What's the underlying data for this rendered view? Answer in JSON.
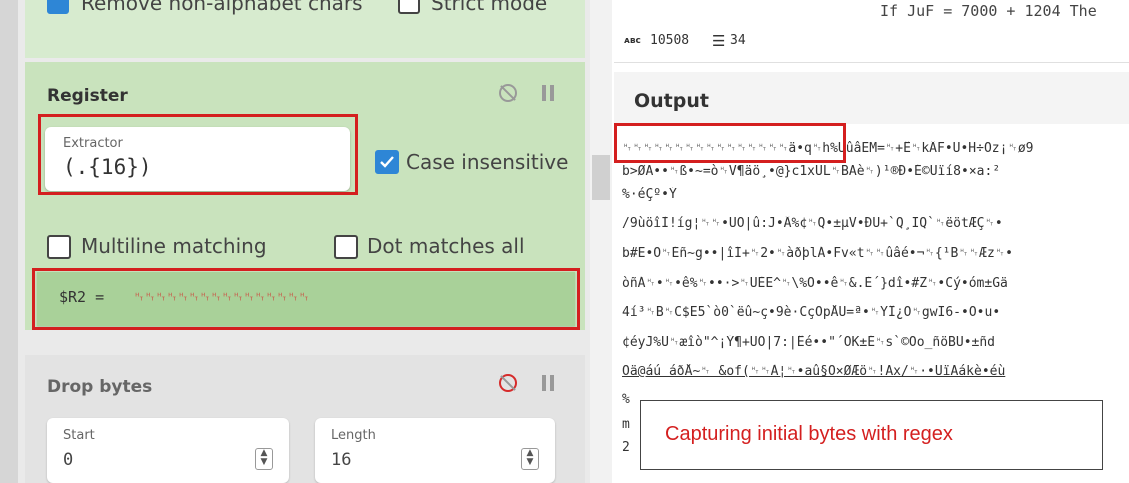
{
  "recipe": {
    "top_options": {
      "remove_label": "Remove non-alphabet chars",
      "strict_label": "Strict mode"
    },
    "register": {
      "title": "Register",
      "extractor_label": "Extractor",
      "extractor_value": "(.{16})",
      "case_label": "Case insensitive",
      "case_checked": true,
      "multiline_label": "Multiline matching",
      "dotall_label": "Dot matches all",
      "output_name": "$R2 =",
      "output_value": "␉␉␉␉␉␉␉␉␉␉␉␉␉␉␉␉"
    },
    "drop_bytes": {
      "title": "Drop bytes",
      "start_label": "Start",
      "start_value": "0",
      "length_label": "Length",
      "length_value": "16"
    }
  },
  "input_status": {
    "top_text": "If JuF = 7000 + 1204 The",
    "length_value": "10508",
    "lines_value": "34"
  },
  "output": {
    "title": "Output",
    "lines": [
      "␉␉␉␉␉␉␉␉␉␉␉␉␉␉␉␉ä•q␉h%ÛûâËM=␉+Ê␉kÂF•Ù•H÷Ôz¡␉ø9",
      "b>ØÃ••␉ß•~=ò␉V¶äö¸•@}c1xÙL␉BÃè␉)¹®Ð•É©Ùïí8•×a:²",
      "%·éÇº•Ý",
      "/9ùöîÌ!íg¦␉␉•ÚÔ|û:J•Â%¢␉Q•±µV•ÐÙ+`Q¸IQ`␉ëötÆÇ␉•",
      "b#Ë•Ö␉Éñ~g••|îÍ+␉2•␉àðþlÁ•Fv«t␉␉ûâé•¬␉{¹B␉␉Æz␉•",
      "òñÁ␉•␉•ê%␉••·>␉ÜÈË^␉\\%O••ê␉&.È´}dî•#Z␉•Cý•óm±Gä",
      "4í³␉B␉C$E5`ò0`ëû~ç•9è·CçOpÅÜ=ª•␉YÎ¿Õ␉gwI6-•Õ•u•",
      "¢éyJ%Ú␉æîò\"^¡Ý¶+UÒ|7:|Êé••\"´ÓK±É␉s`©Oo_ñöBÛ•±ñd",
      "Oä@áú áðÅ~␉ &of(␉␉À¦␉•aû§Ò×ØÆö␉!Äx/␉·•ÛïAákè•éù",
      "%",
      "m",
      "2"
    ]
  },
  "annotation": {
    "callout_text": "Capturing initial bytes with regex"
  },
  "colors": {
    "accent_green": "#c9e3bd",
    "highlight_red": "#d41f1f",
    "checkbox_blue": "#2e86d6"
  }
}
